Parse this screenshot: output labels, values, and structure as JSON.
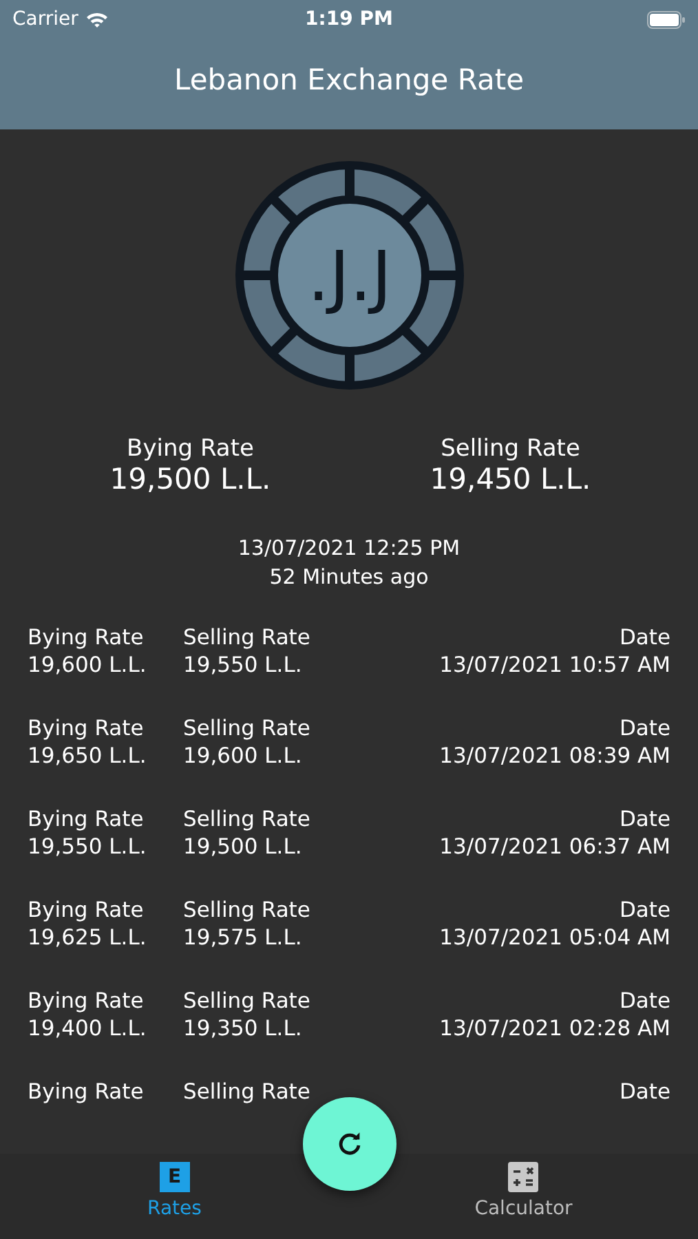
{
  "status_bar": {
    "carrier": "Carrier",
    "time": "1:19 PM"
  },
  "header": {
    "title": "Lebanon Exchange Rate"
  },
  "logo": {
    "text": ".J.J"
  },
  "current": {
    "buy_label": "Bying Rate",
    "buy_value": "19,500 L.L.",
    "sell_label": "Selling Rate",
    "sell_value": "19,450 L.L.",
    "date": "13/07/2021 12:25 PM",
    "ago": "52 Minutes ago"
  },
  "history": [
    {
      "buy_label": "Bying Rate",
      "buy": "19,600 L.L.",
      "sell_label": "Selling Rate",
      "sell": "19,550 L.L.",
      "date_label": "Date",
      "date": "13/07/2021 10:57 AM"
    },
    {
      "buy_label": "Bying Rate",
      "buy": "19,650 L.L.",
      "sell_label": "Selling Rate",
      "sell": "19,600 L.L.",
      "date_label": "Date",
      "date": "13/07/2021 08:39 AM"
    },
    {
      "buy_label": "Bying Rate",
      "buy": "19,550 L.L.",
      "sell_label": "Selling Rate",
      "sell": "19,500 L.L.",
      "date_label": "Date",
      "date": "13/07/2021 06:37 AM"
    },
    {
      "buy_label": "Bying Rate",
      "buy": "19,625 L.L.",
      "sell_label": "Selling Rate",
      "sell": "19,575 L.L.",
      "date_label": "Date",
      "date": "13/07/2021 05:04 AM"
    },
    {
      "buy_label": "Bying Rate",
      "buy": "19,400 L.L.",
      "sell_label": "Selling Rate",
      "sell": "19,350 L.L.",
      "date_label": "Date",
      "date": "13/07/2021 02:28 AM"
    },
    {
      "buy_label": "Bying Rate",
      "sell_label": "Selling Rate",
      "date_label": "Date"
    }
  ],
  "tabs": [
    {
      "label": "Rates",
      "kind": "letter",
      "icon_text": "E",
      "selected": true
    },
    {
      "label": "Calculator",
      "kind": "calculator",
      "selected": false
    }
  ]
}
